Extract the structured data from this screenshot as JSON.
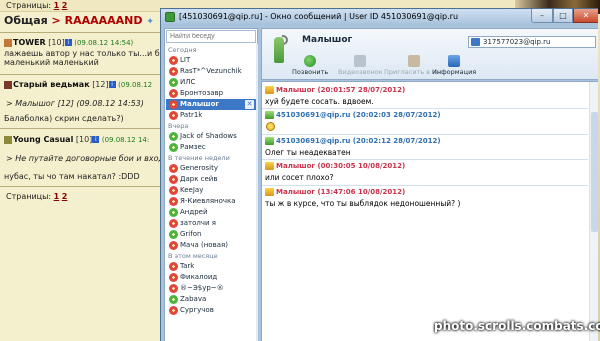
{
  "forum": {
    "pages_label": "Страницы:",
    "pages_top": [
      "1",
      "2"
    ],
    "thread_prefix": "Общая",
    "thread_arrow": ">",
    "thread_name": "RAAAAAAND",
    "thread_star": "✦",
    "posts": [
      {
        "nick": "TOWER",
        "level": "[10]",
        "info": "i",
        "date": "(09.08.12 14:54)",
        "lines": [
          "лажаешь автор у нас только ты...и б",
          "маленький маленький"
        ]
      },
      {
        "nick": "Старый ведьмак",
        "level": "[12]",
        "info": "i",
        "date": "(09.08.12",
        "lines": []
      },
      {
        "nick": "Young Casual",
        "level": "[10]",
        "info": "i",
        "date": "(09.08.12 14:",
        "lines": []
      }
    ],
    "quote1": "> Малышог [12] (09.08.12 14:53)",
    "post2_text": "Балаболка) скрин сделать?)",
    "quote2": "> Не путайте договорные бои и вход",
    "post3_text": "нубас, ты чо там накатал? :DDD",
    "pages_bottom": [
      "1",
      "2"
    ]
  },
  "window": {
    "title": "[451030691@qip.ru] - Окно сообщений | User ID 451030691@qip.ru",
    "btn_min": "–",
    "btn_max": "□",
    "btn_close": "✕"
  },
  "sidebar": {
    "search_placeholder": "Найти беседу",
    "sections": {
      "today": "Сегодня",
      "yesterday": "Вчера",
      "week": "В течение недели",
      "month": "В этом месяце"
    },
    "today": [
      "LIT",
      "RasT*^Vezunchik",
      "ИЛС",
      "Бронтозавр",
      "Малышог",
      "Patr1k"
    ],
    "yesterday": [
      "Jack of Shadows",
      "Рамзес"
    ],
    "week": [
      "Generosity",
      "Дарк сейв",
      "KeeJay",
      "Я-Киевляночка",
      "Андрей",
      "затолчи я",
      "Grifon",
      "Мача (новая)"
    ],
    "month": [
      "Tark",
      "Фикалоид",
      "®~Э$ур~®",
      "Zabava",
      "Сургучов"
    ],
    "selected_close": "✕"
  },
  "chat_header": {
    "contact_name": "Малышог",
    "user_id": "317577023@qip.ru",
    "tools": {
      "call": "Позвонить",
      "video": "Видеозвонок",
      "invite": "Пригласить в чат",
      "info": "Информация"
    }
  },
  "messages": [
    {
      "who": "them",
      "header": "Малышог (20:01:57 28/07/2012)",
      "text": "хуй будете сосать. вдвоем."
    },
    {
      "who": "me",
      "header": "451030691@qip.ru (20:02:03 28/07/2012)",
      "text": "",
      "smile": true
    },
    {
      "who": "me",
      "header": "451030691@qip.ru (20:02:12 28/07/2012)",
      "text": "Олег ты неадекватен"
    },
    {
      "who": "them",
      "header": "Малышог (00:30:05 10/08/2012)",
      "text": "или сосет плохо?"
    },
    {
      "who": "them",
      "header": "Малышог (13:47:06 10/08/2012)",
      "text": "ты ж в курсе, что ты выблядок недоношенный? )"
    }
  ],
  "watermark": "photo.scrolls.combats.com"
}
